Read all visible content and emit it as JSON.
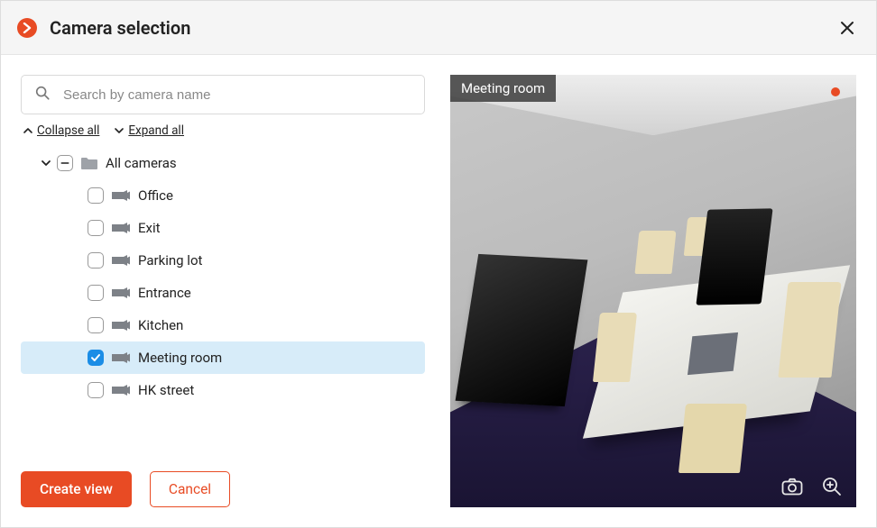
{
  "header": {
    "title": "Camera selection"
  },
  "search": {
    "placeholder": "Search by camera name",
    "value": ""
  },
  "tree_controls": {
    "collapse_label": "Collapse all",
    "expand_label": "Expand all"
  },
  "tree": {
    "group_label": "All cameras",
    "group_expanded": true,
    "group_state": "indeterminate",
    "cameras": [
      {
        "label": "Office",
        "checked": false,
        "selected": false
      },
      {
        "label": "Exit",
        "checked": false,
        "selected": false
      },
      {
        "label": "Parking lot",
        "checked": false,
        "selected": false
      },
      {
        "label": "Entrance",
        "checked": false,
        "selected": false
      },
      {
        "label": "Kitchen",
        "checked": false,
        "selected": false
      },
      {
        "label": "Meeting room",
        "checked": true,
        "selected": true
      },
      {
        "label": "HK street",
        "checked": false,
        "selected": false
      }
    ]
  },
  "preview": {
    "camera_label": "Meeting room",
    "recording": true
  },
  "buttons": {
    "primary": "Create view",
    "secondary": "Cancel"
  },
  "colors": {
    "accent": "#e84b24",
    "selection": "#d7ecf9",
    "checkbox_checked": "#1b8de6"
  }
}
